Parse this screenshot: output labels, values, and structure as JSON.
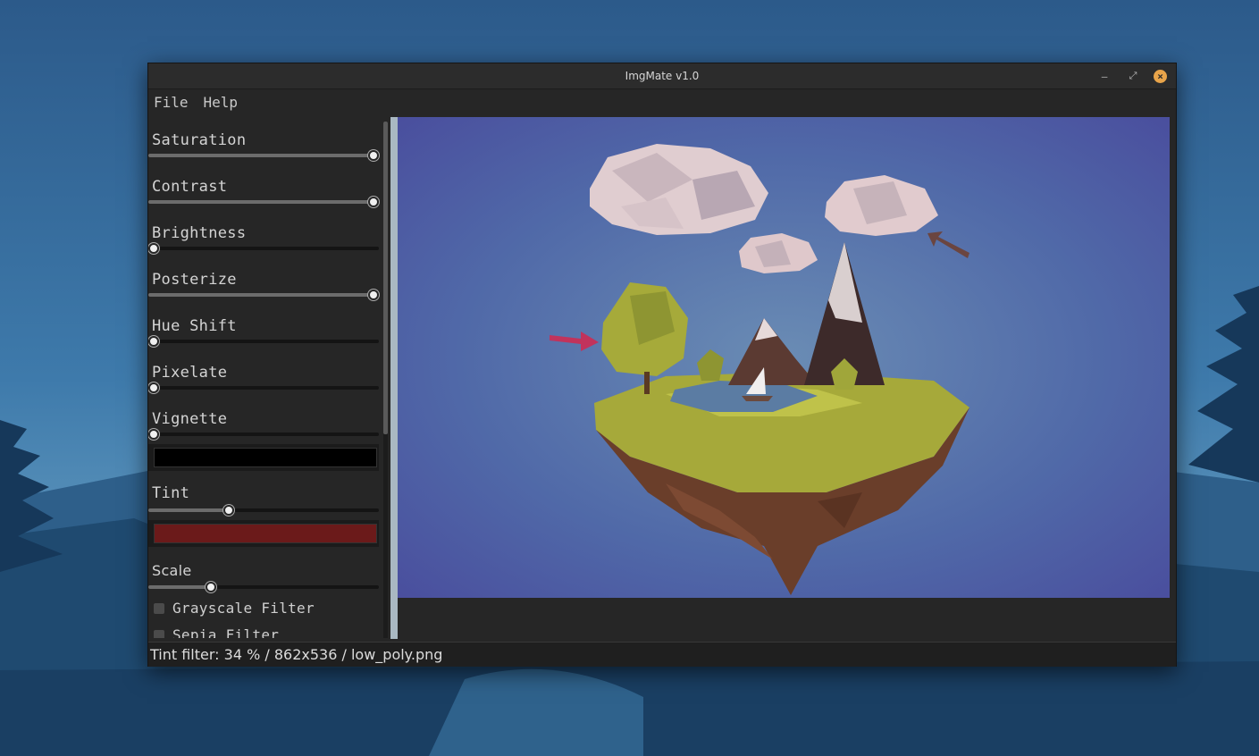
{
  "window": {
    "title": "ImgMate v1.0"
  },
  "menu": {
    "file": "File",
    "help": "Help"
  },
  "sliders": [
    {
      "label": "Saturation",
      "fraction": 1.0
    },
    {
      "label": "Contrast",
      "fraction": 1.0
    },
    {
      "label": "Brightness",
      "fraction": 0.0
    },
    {
      "label": "Posterize",
      "fraction": 1.0
    },
    {
      "label": "Hue Shift",
      "fraction": 0.0
    },
    {
      "label": "Pixelate",
      "fraction": 0.0
    },
    {
      "label": "Vignette",
      "fraction": 0.0
    }
  ],
  "vignette_color": "#000000",
  "tint": {
    "label": "Tint",
    "fraction": 0.34,
    "color": "#6b1a1a"
  },
  "scale": {
    "label": "Scale",
    "fraction": 0.26
  },
  "checkboxes": [
    {
      "label": "Grayscale Filter",
      "checked": false
    },
    {
      "label": "Sepia Filter",
      "checked": false
    }
  ],
  "status": {
    "text": "Tint filter: 34 % / 862x536 / low_poly.png"
  },
  "colors": {
    "window_bg": "#262626",
    "image_bg": "#4a5da0",
    "accent_close": "#e8a44a"
  },
  "icons": {
    "minimize": "minimize-icon",
    "restore": "restore-icon",
    "close": "close-icon"
  }
}
